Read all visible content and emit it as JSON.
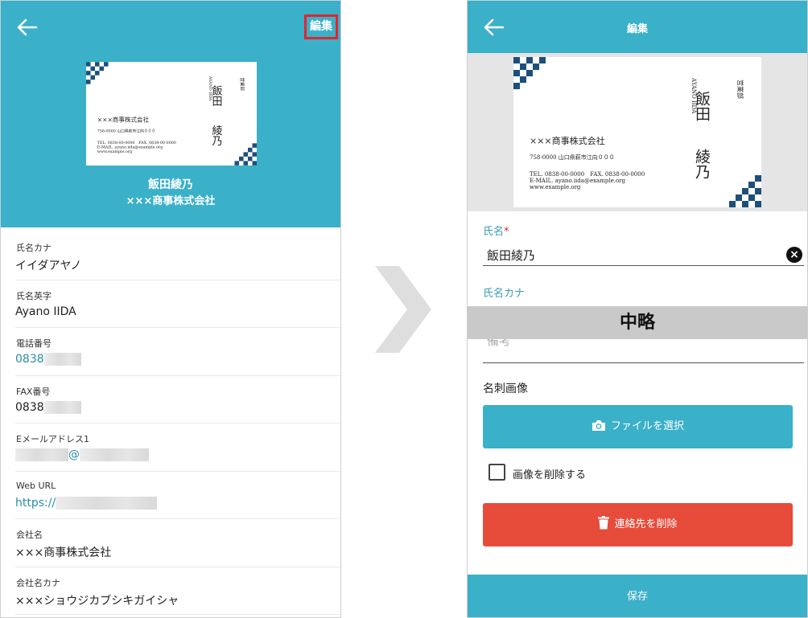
{
  "detail": {
    "edit_label": "編集",
    "contact_name": "飯田綾乃",
    "company_name": "×××商事株式会社",
    "fields": [
      {
        "label": "氏名カナ",
        "value": "イイダアヤノ"
      },
      {
        "label": "氏名英字",
        "value": "Ayano IIDA"
      },
      {
        "label": "電話番号",
        "value": "0838"
      },
      {
        "label": "FAX番号",
        "value": "0838"
      },
      {
        "label": "Eメールアドレス1",
        "value": "@"
      },
      {
        "label": "Web URL",
        "value": "https://"
      },
      {
        "label": "会社名",
        "value": "×××商事株式会社"
      },
      {
        "label": "会社名カナ",
        "value": "×××ショウジカブシキガイシャ"
      }
    ]
  },
  "card": {
    "company": "×××商事株式会社",
    "address": "758-0000 山口県萩市江向０００",
    "tel_fax": "TEL. 0838-00-0000　FAX. 0838-00-0000",
    "email": "E-MAIL. ayano.iida@example.org",
    "web": "www.example.org",
    "name_en": "AYANO IIDA",
    "department": "営業部",
    "family_name": "飯田",
    "given_name": "綾乃"
  },
  "edit": {
    "title": "編集",
    "name_label": "氏名",
    "required_mark": "*",
    "name_value": "飯田綾乃",
    "kana_label": "氏名カナ",
    "omitted_label": "中略",
    "notes_label": "備考",
    "card_image_label": "名刺画像",
    "select_file_label": "ファイルを選択",
    "delete_image_label": "画像を削除する",
    "delete_image_checked": false,
    "delete_contact_label": "連絡先を削除",
    "save_label": "保存"
  },
  "colors": {
    "teal": "#3ab0c9",
    "red_highlight": "#e0262e",
    "delete_red": "#e74b3a",
    "link": "#2a8da6",
    "card_navy": "#1d4f7a"
  }
}
